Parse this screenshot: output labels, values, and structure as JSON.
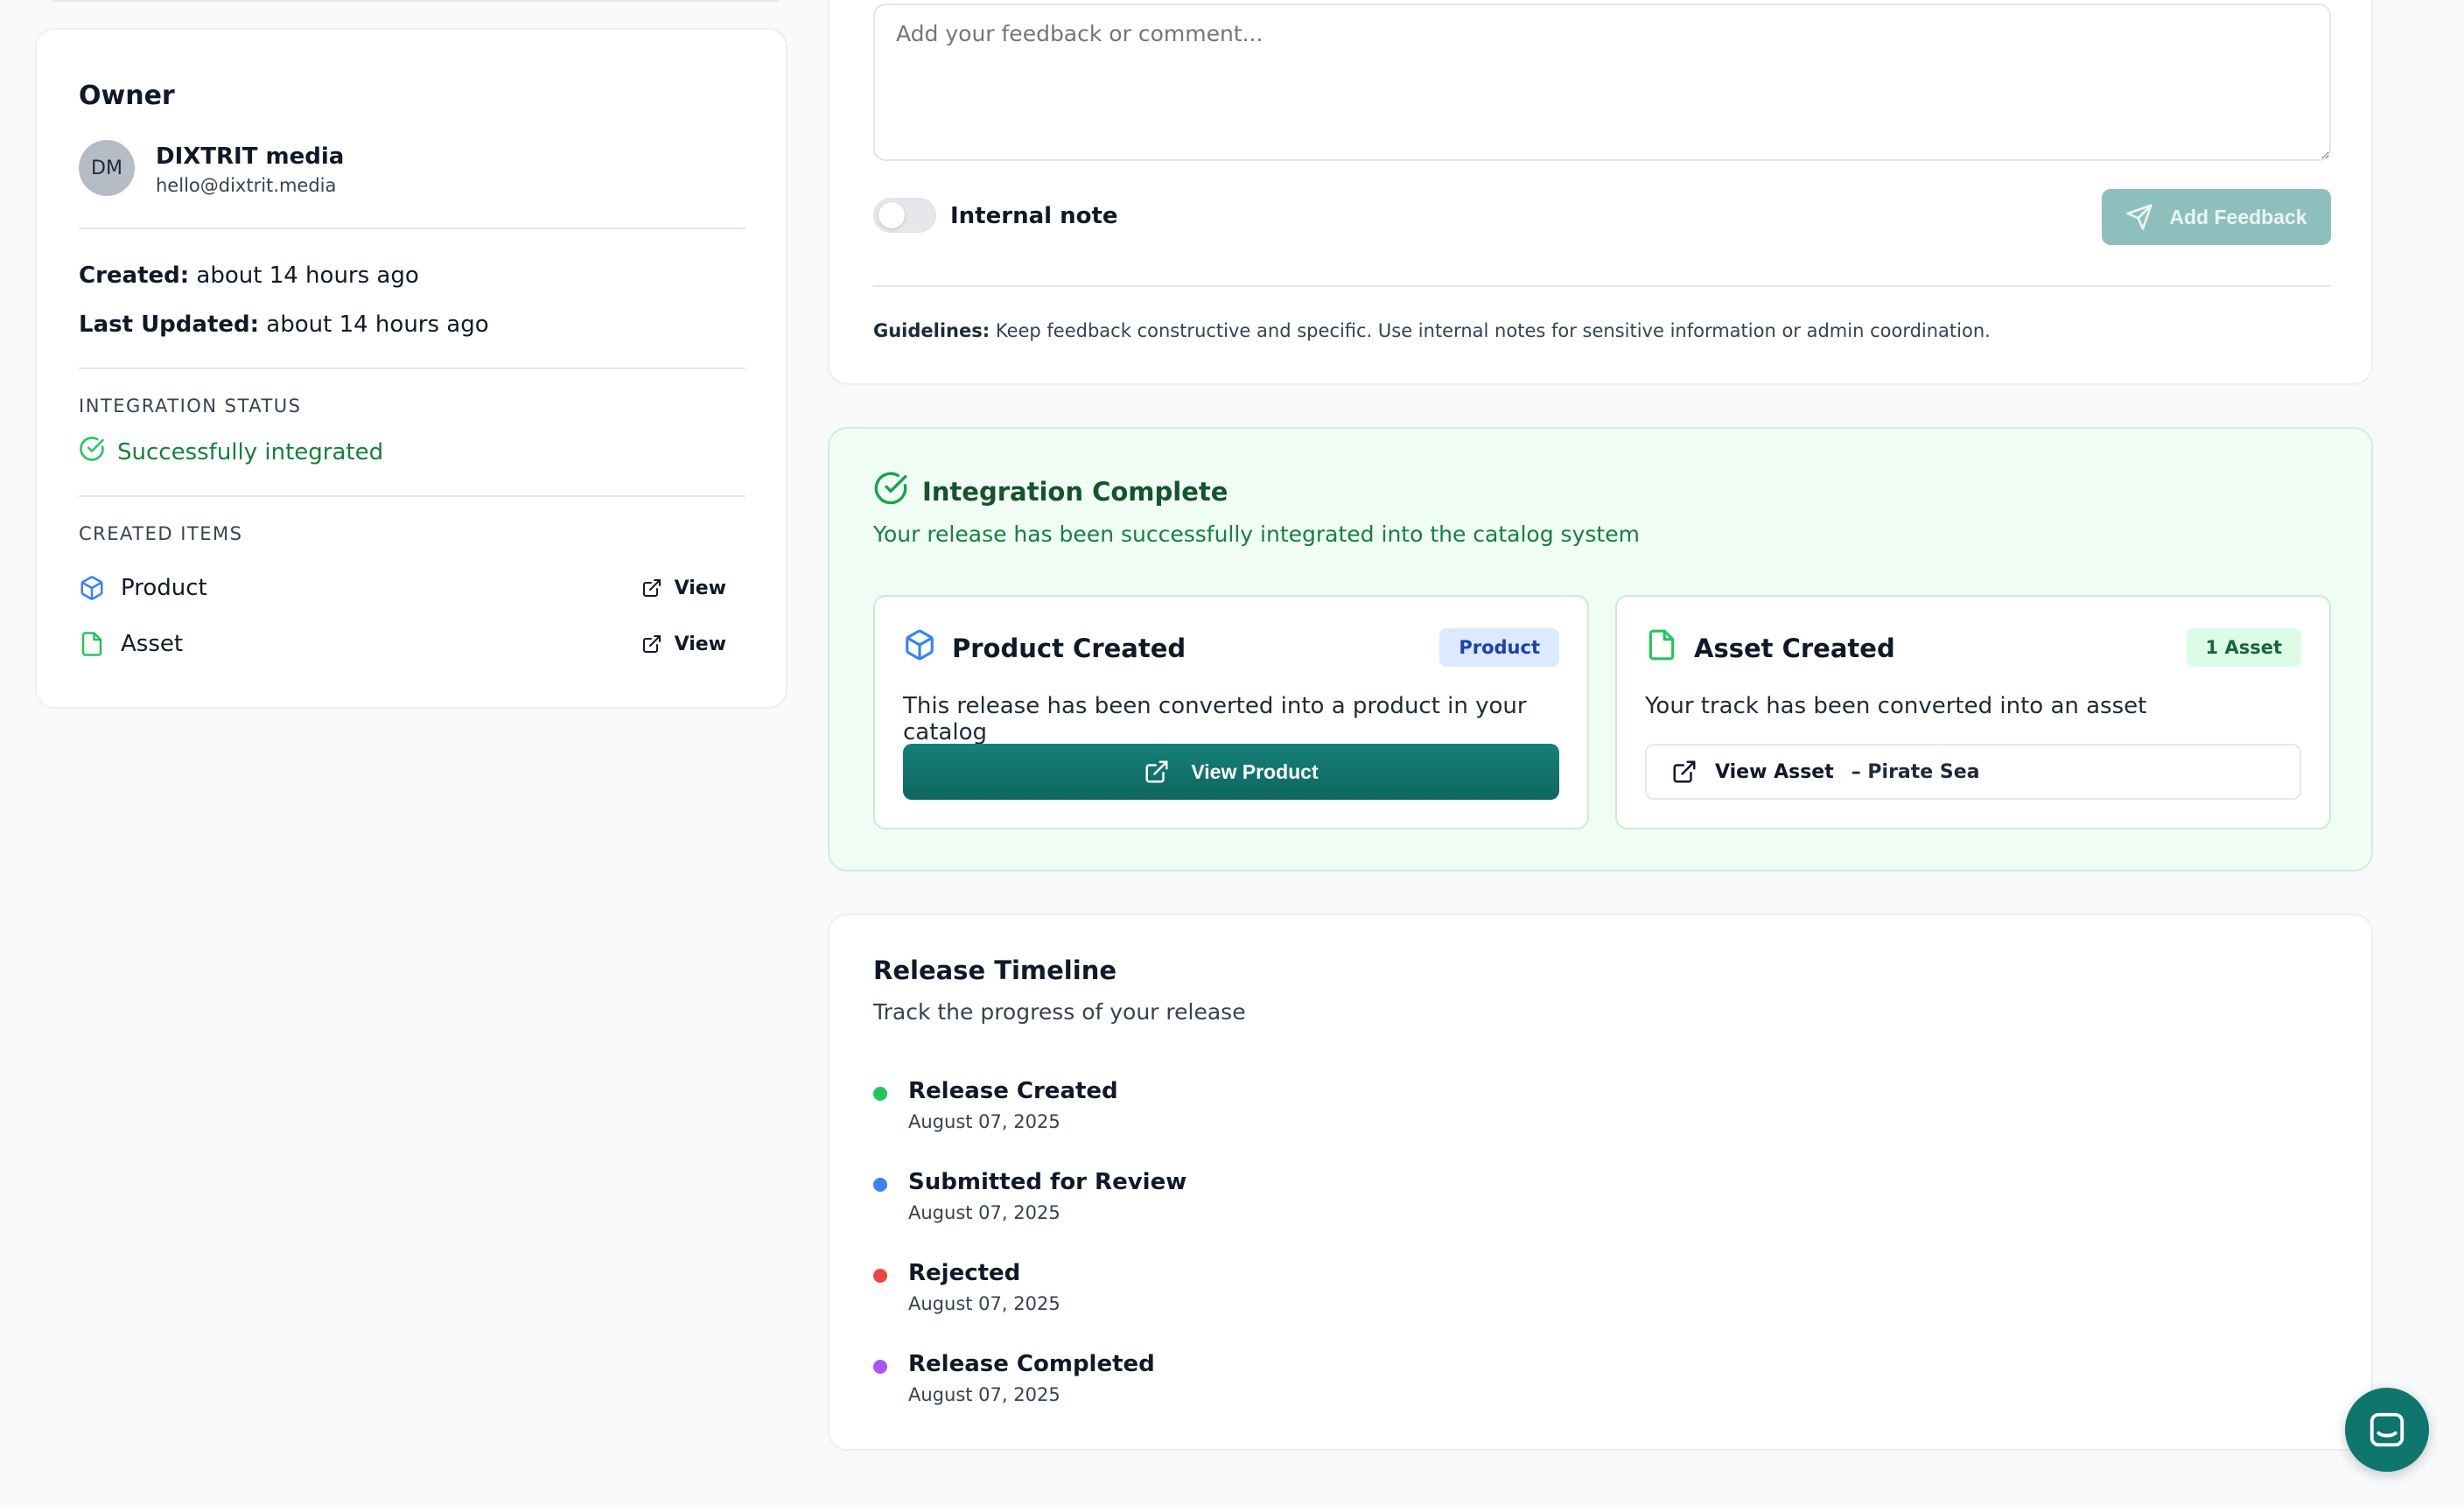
{
  "owner": {
    "title": "Owner",
    "initials": "DM",
    "name": "DIXTRIT media",
    "email": "hello@dixtrit.media",
    "created_label": "Created:",
    "created_value": "about 14 hours ago",
    "updated_label": "Last Updated:",
    "updated_value": "about 14 hours ago",
    "integration_status_label": "INTEGRATION STATUS",
    "integration_status": "Successfully integrated",
    "created_items_label": "CREATED ITEMS",
    "created_items": [
      {
        "label": "Product",
        "link": "View",
        "icon": "cube-icon"
      },
      {
        "label": "Asset",
        "link": "View",
        "icon": "file-icon"
      }
    ]
  },
  "feedback": {
    "placeholder": "Add your feedback or comment...",
    "internal_note_label": "Internal note",
    "internal_note_on": false,
    "add_button": "Add Feedback",
    "guidelines_label": "Guidelines:",
    "guidelines_text": "Keep feedback constructive and specific. Use internal notes for sensitive information or admin coordination."
  },
  "integration": {
    "title": "Integration Complete",
    "subtitle": "Your release has been successfully integrated into the catalog system",
    "product_card": {
      "title": "Product Created",
      "badge": "Product",
      "description": "This release has been converted into a product in your catalog",
      "button": "View Product"
    },
    "asset_card": {
      "title": "Asset Created",
      "badge": "1 Asset",
      "description": "Your track has been converted into an asset",
      "button": "View Asset",
      "button_suffix": "– Pirate Sea"
    }
  },
  "timeline": {
    "title": "Release Timeline",
    "subtitle": "Track the progress of your release",
    "items": [
      {
        "title": "Release Created",
        "date": "August 07, 2025",
        "color": "#22c55e"
      },
      {
        "title": "Submitted for Review",
        "date": "August 07, 2025",
        "color": "#3b82f6"
      },
      {
        "title": "Rejected",
        "date": "August 07, 2025",
        "color": "#ef4444"
      },
      {
        "title": "Release Completed",
        "date": "August 07, 2025",
        "color": "#a855f7"
      }
    ]
  },
  "colors": {
    "accent": "#0f766e",
    "success": "#15803d",
    "product_icon": "#3b82f6",
    "asset_icon": "#22c55e"
  }
}
